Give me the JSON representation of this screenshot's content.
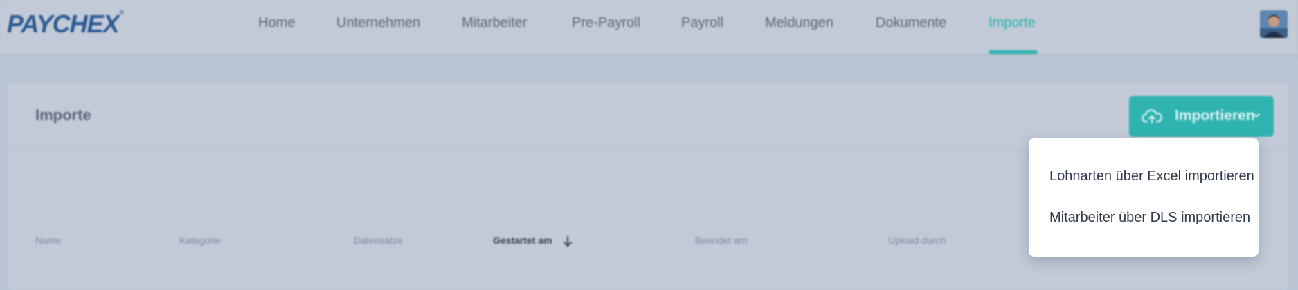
{
  "brand": {
    "logo_text": "PAYCHEX",
    "logo_mark": "®"
  },
  "nav": {
    "items": [
      {
        "label": "Home"
      },
      {
        "label": "Unternehmen"
      },
      {
        "label": "Mitarbeiter"
      },
      {
        "label": "Pre-Payroll"
      },
      {
        "label": "Payroll"
      },
      {
        "label": "Meldungen"
      },
      {
        "label": "Dokumente"
      },
      {
        "label": "Importe"
      }
    ],
    "active": "Importe",
    "accent_color": "#27b3b0"
  },
  "user": {
    "avatar_icon": "user-avatar"
  },
  "panel": {
    "title": "Importe",
    "import_button": {
      "label": "Importieren",
      "icon": "cloud-upload-icon",
      "color": "#2fb3b0"
    },
    "table": {
      "columns": [
        {
          "label": "Name"
        },
        {
          "label": "Kategorie"
        },
        {
          "label": "Datensätze"
        },
        {
          "label": "Gestartet am",
          "sorted": "descending"
        },
        {
          "label": "Beendet am"
        },
        {
          "label": "Upload durch"
        }
      ]
    }
  },
  "dropdown": {
    "items": [
      {
        "label": "Lohnarten über Excel importieren"
      },
      {
        "label": "Mitarbeiter über DLS importieren"
      }
    ]
  }
}
